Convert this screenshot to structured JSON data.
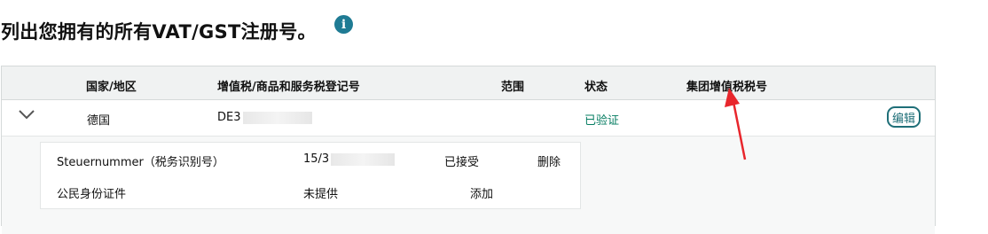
{
  "page": {
    "title": "列出您拥有的所有VAT/GST注册号。",
    "info_icon": "info-icon",
    "accent_color": "#1f7b94",
    "success_color": "#067d62",
    "annotation_color": "#e8262c"
  },
  "table": {
    "headers": {
      "country": "国家/地区",
      "vat_number": "增值税/商品和服务税登记号",
      "scope": "范围",
      "status": "状态",
      "group_vat": "集团增值税税号"
    },
    "rows": [
      {
        "country": "德国",
        "vat_number": "DE3",
        "scope": "",
        "status": "已验证",
        "group_vat": "",
        "edit_label": "编辑",
        "expanded": true
      }
    ],
    "sub_rows": [
      {
        "label": "Steuernummer（税务识别号）",
        "value": "15/3",
        "status": "已接受",
        "action": "删除"
      },
      {
        "label": "公民身份证件",
        "value": "未提供",
        "status": "",
        "action": "添加"
      }
    ]
  }
}
